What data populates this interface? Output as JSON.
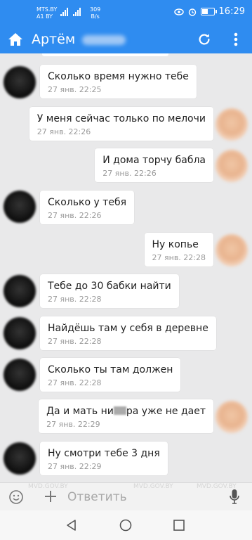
{
  "status_bar": {
    "carrier1": "MTS.BY",
    "carrier2": "A1 BY",
    "speed_value": "309",
    "speed_unit": "B/s",
    "time": "16:29"
  },
  "toolbar": {
    "title": "Артём",
    "accent_color": "#2f8cf0"
  },
  "messages": [
    {
      "dir": "in",
      "text": "Сколько время нужно тебе",
      "time": "27 янв. 22:25"
    },
    {
      "dir": "out",
      "text": "У меня сейчас только по мелочи",
      "time": "27 янв. 22:26"
    },
    {
      "dir": "out",
      "text": "И дома торчу бабла",
      "time": "27 янв. 22:26"
    },
    {
      "dir": "in",
      "text": "Сколько у тебя",
      "time": "27 янв. 22:26"
    },
    {
      "dir": "out",
      "text": "Ну копье",
      "time": "27 янв. 22:28"
    },
    {
      "dir": "in",
      "text": "Тебе до 30 бабки найти",
      "time": "27 янв. 22:28"
    },
    {
      "dir": "in",
      "text": "Найдёшь там у себя в деревне",
      "time": "27 янв. 22:28"
    },
    {
      "dir": "in",
      "text": "Сколько ты там должен",
      "time": "27 янв. 22:28"
    },
    {
      "dir": "out",
      "text_before": "Да и мать ни",
      "text_after": "ра уже не дает",
      "time": "27 янв. 22:29"
    },
    {
      "dir": "in",
      "text": "Ну смотри тебе 3 дня",
      "time": "27 янв. 22:29"
    }
  ],
  "composer": {
    "placeholder": "Ответить",
    "watermarks": [
      "MVD.GOV.BY",
      "MVD.GOV.BY",
      "MVD.GOV.BY"
    ]
  },
  "icons": [
    "home-icon",
    "refresh-icon",
    "more-vert-icon",
    "smile-icon",
    "plus-icon",
    "mic-icon",
    "back-icon",
    "home-nav-icon",
    "recent-apps-icon"
  ]
}
